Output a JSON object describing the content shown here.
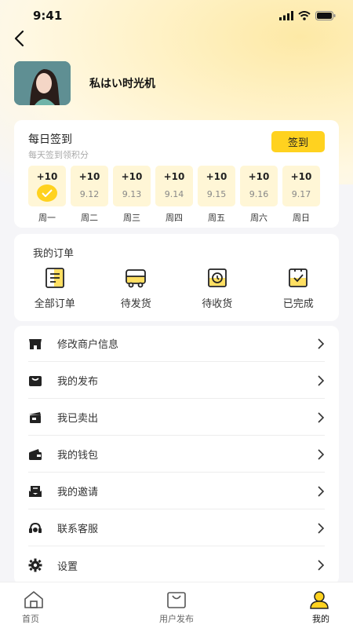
{
  "status": {
    "time": "9:41"
  },
  "profile": {
    "username": "私はい时光机"
  },
  "checkin": {
    "title": "每日签到",
    "subtitle": "每天签到领积分",
    "button_label": "签到",
    "days": [
      {
        "points": "+10",
        "date": "",
        "checked": true,
        "weekday": "周一"
      },
      {
        "points": "+10",
        "date": "9.12",
        "checked": false,
        "weekday": "周二"
      },
      {
        "points": "+10",
        "date": "9.13",
        "checked": false,
        "weekday": "周三"
      },
      {
        "points": "+10",
        "date": "9.14",
        "checked": false,
        "weekday": "周四"
      },
      {
        "points": "+10",
        "date": "9.15",
        "checked": false,
        "weekday": "周五"
      },
      {
        "points": "+10",
        "date": "9.16",
        "checked": false,
        "weekday": "周六"
      },
      {
        "points": "+10",
        "date": "9.17",
        "checked": false,
        "weekday": "周日"
      }
    ]
  },
  "orders": {
    "title": "我的订单",
    "items": [
      {
        "label": "全部订单",
        "icon": "all-orders-icon"
      },
      {
        "label": "待发货",
        "icon": "to-ship-icon"
      },
      {
        "label": "待收货",
        "icon": "to-receive-icon"
      },
      {
        "label": "已完成",
        "icon": "completed-icon"
      }
    ]
  },
  "menu": {
    "items": [
      {
        "label": "修改商户信息",
        "icon": "store-icon"
      },
      {
        "label": "我的发布",
        "icon": "publish-icon"
      },
      {
        "label": "我已卖出",
        "icon": "sold-icon"
      },
      {
        "label": "我的钱包",
        "icon": "wallet-icon"
      },
      {
        "label": "我的邀请",
        "icon": "invite-icon"
      },
      {
        "label": "联系客服",
        "icon": "headset-icon"
      },
      {
        "label": "设置",
        "icon": "gear-icon"
      }
    ]
  },
  "tabbar": {
    "tabs": [
      {
        "label": "首页",
        "icon": "home-icon",
        "active": false
      },
      {
        "label": "用户发布",
        "icon": "bag-icon",
        "active": false
      },
      {
        "label": "我的",
        "icon": "user-icon",
        "active": true
      }
    ]
  },
  "colors": {
    "accent": "#ffd21f",
    "day_bg": "#fff6d6",
    "page_bg": "#f5f5f8"
  }
}
